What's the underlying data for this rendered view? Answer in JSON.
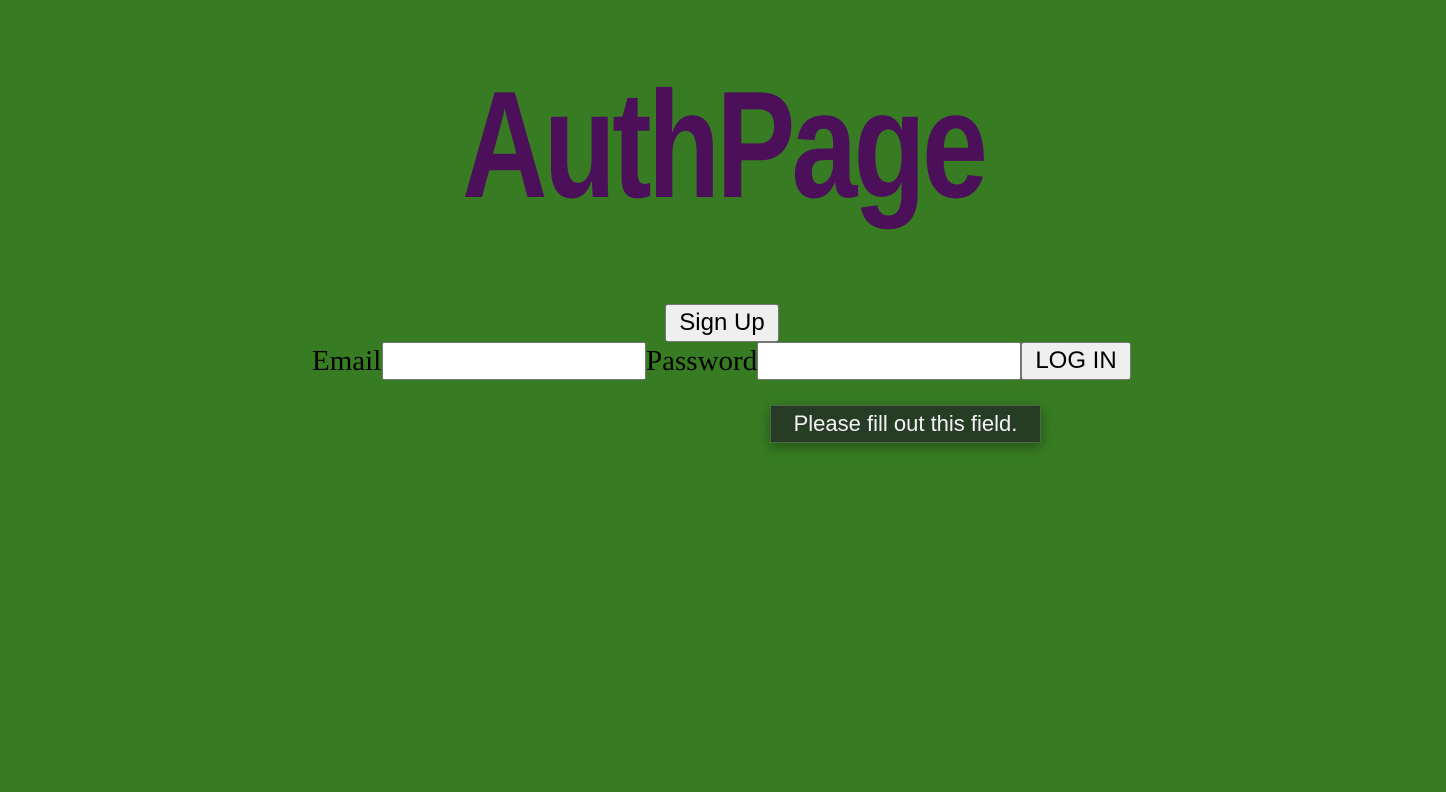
{
  "page": {
    "title": "AuthPage"
  },
  "signup": {
    "label": "Sign Up"
  },
  "login_form": {
    "email_label": "Email",
    "email_value": "",
    "password_label": "Password",
    "password_value": "",
    "login_label": "LOG IN"
  },
  "validation": {
    "message": "Please fill out this field."
  },
  "colors": {
    "background": "#377c22",
    "title": "#4c0f5a",
    "tooltip_background": "#263c25"
  }
}
